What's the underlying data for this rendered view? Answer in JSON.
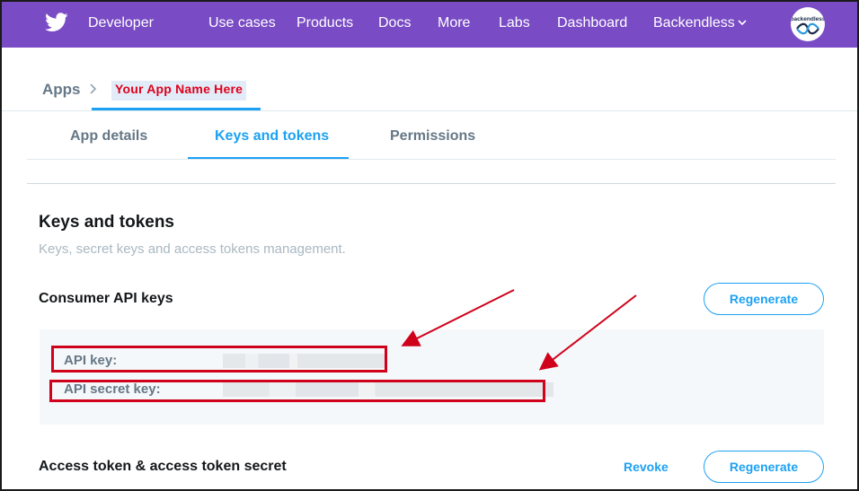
{
  "nav": {
    "brand": "Developer",
    "links": [
      "Use cases",
      "Products",
      "Docs",
      "More",
      "Labs",
      "Dashboard",
      "Backendless"
    ],
    "account_logo_text": "backendless"
  },
  "breadcrumb": {
    "root": "Apps",
    "current": "Your App Name Here"
  },
  "tabs": [
    {
      "label": "App details",
      "active": false
    },
    {
      "label": "Keys and tokens",
      "active": true
    },
    {
      "label": "Permissions",
      "active": false
    }
  ],
  "section": {
    "title": "Keys and tokens",
    "subtitle": "Keys, secret keys and access tokens management."
  },
  "consumer": {
    "title": "Consumer API keys",
    "regenerate_label": "Regenerate",
    "api_key_label": "API key:",
    "api_secret_label": "API secret key:"
  },
  "access": {
    "title": "Access token & access token secret",
    "revoke_label": "Revoke",
    "regenerate_label": "Regenerate"
  },
  "colors": {
    "nav_bg": "#794bc4",
    "accent": "#1da1f2",
    "annotation_red": "#d0021b"
  }
}
